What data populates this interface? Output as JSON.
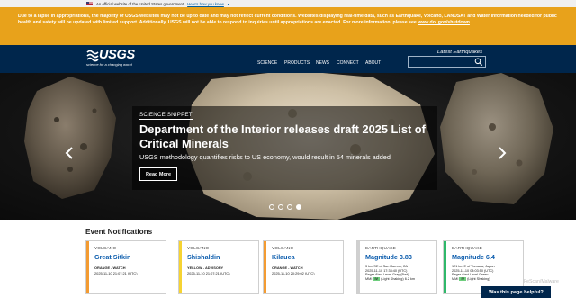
{
  "gov_banner": {
    "text": "An official website of the United States government",
    "link": "Here's how you know"
  },
  "alert": {
    "text": "Due to a lapse in appropriations, the majority of USGS websites may not be up to date and may not reflect current conditions. Websites displaying real-time data, such as Earthquake, Volcano, LANDSAT and Water information needed for public health and safety will be updated with limited support. Additionally, USGS will not be able to respond to inquiries until appropriations are enacted. For more information, please see",
    "link": "www.doi.gov/shutdown",
    "end": "."
  },
  "header": {
    "logo_text": "USGS",
    "logo_tagline": "science for a changing world",
    "nav": [
      "SCIENCE",
      "PRODUCTS",
      "NEWS",
      "CONNECT",
      "ABOUT"
    ],
    "latest_label": "Latest Earthquakes",
    "search_placeholder": "",
    "search_icon": "search-icon"
  },
  "hero": {
    "tag": "SCIENCE SNIPPET",
    "title": "Department of the Interior releases draft 2025 List of Critical Minerals",
    "subtitle": "USGS methodology quantifies risks to US economy, would result in 54 minerals added",
    "button": "Read More",
    "slides": 4,
    "active_slide": 4
  },
  "events": {
    "title": "Event Notifications",
    "cards": [
      {
        "type": "VOLCANO",
        "name": "Great Sitkin",
        "status": "ORANGE - WATCH",
        "time": "2025-11-10 21:07:21 (UTC)",
        "color": "#f39b32"
      },
      {
        "type": "VOLCANO",
        "name": "Shishaldin",
        "status": "YELLOW - ADVISORY",
        "time": "2025-11-10 21:07:21 (UTC)",
        "color": "#f6d332"
      },
      {
        "type": "VOLCANO",
        "name": "Kilauea",
        "status": "ORANGE - WATCH",
        "time": "2025-11-10 20:29:02 (UTC)",
        "color": "#f39b32"
      },
      {
        "type": "EARTHQUAKE",
        "name": "Magnitude 3.83",
        "loc1": "3 km SE of San Ramon, CA",
        "loc2": "2025-11-10 17:33:40 (UTC)",
        "loc3": "Pager Alert Level Gray (Bad)",
        "mmi_label": "MMI",
        "mmi": "IV",
        "mmi_desc": "(Light Shaking) 6.2 km",
        "color": "#d0d0d0"
      },
      {
        "type": "EARTHQUAKE",
        "name": "Magnitude 6.4",
        "loc1": "121 km E of Yamada, Japan",
        "loc2": "2025-11-10 08:03:50 (UTC)",
        "loc3": "Pager Alert Level Green",
        "mmi_label": "MMI",
        "mmi": "IV",
        "mmi_desc": "(Light Shaking)",
        "color": "#2fb86a"
      }
    ]
  },
  "feedback": "Was this page helpful?",
  "watermark": "FeScan/Malware"
}
